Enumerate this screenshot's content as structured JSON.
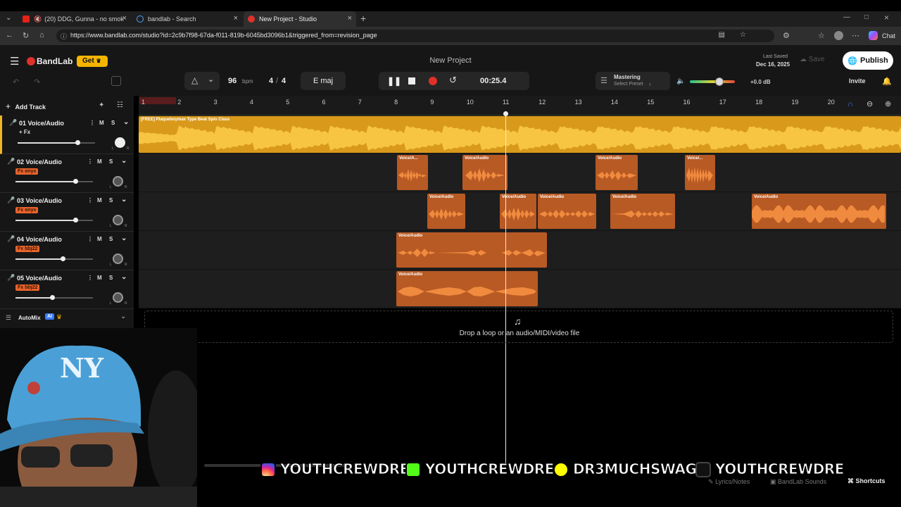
{
  "browser": {
    "tabs": [
      {
        "label": "(20) DDG, Gunna - no smok",
        "active": false
      },
      {
        "label": "bandlab - Search",
        "active": false
      },
      {
        "label": "New Project - Studio",
        "active": true
      }
    ],
    "new_tab_icon": "plus-icon",
    "url": "https://www.bandlab.com/studio?id=2c9b7f98-67da-f011-819b-6045bd3096b1&triggered_from=revision_page",
    "chat_label": "Chat"
  },
  "header": {
    "brand": "BandLab",
    "get_label": "Get",
    "project_title": "New Project",
    "last_saved_label": "Last Saved",
    "last_saved_date": "Dec 16, 2025",
    "save_label": "Save",
    "publish_label": "Publish",
    "invite_label": "Invite"
  },
  "toolbar": {
    "tempo": "96",
    "tempo_unit": "bpm",
    "time_sig_num": "4",
    "time_sig_sep": "/",
    "time_sig_den": "4",
    "key": "E maj",
    "time": "00:25.4",
    "mastering_label": "Mastering",
    "mastering_preset": "Select Preset",
    "master_volume": "+0.0 dB"
  },
  "ruler": {
    "bars": [
      "1",
      "2",
      "3",
      "4",
      "5",
      "6",
      "7",
      "8",
      "9",
      "10",
      "11",
      "12",
      "13",
      "14",
      "15",
      "16",
      "17",
      "18",
      "19",
      "20"
    ]
  },
  "sidebar": {
    "add_track_label": "Add Track",
    "automix_label": "AutoMix",
    "ai_badge": "AI"
  },
  "tracks": [
    {
      "name": "01  Voice/Audio",
      "fx": "+ Fx",
      "fx_tag": false,
      "volume": 0.77,
      "dial_on": true
    },
    {
      "name": "02  Voice/Audio",
      "fx": "Fx onyx",
      "fx_tag": true,
      "volume": 0.77,
      "dial_on": false
    },
    {
      "name": "03  Voice/Audio",
      "fx": "Fx onyx",
      "fx_tag": true,
      "volume": 0.77,
      "dial_on": false
    },
    {
      "name": "04  Voice/Audio",
      "fx": "Fx bbj22",
      "fx_tag": true,
      "volume": 0.61,
      "dial_on": false
    },
    {
      "name": "05  Voice/Audio",
      "fx": "Fx bbj22",
      "fx_tag": true,
      "volume": 0.47,
      "dial_on": false
    }
  ],
  "clips": {
    "beat_label": "[FREE] Plaqueboymax Type Beat Spin Class",
    "clip_label": "Voice/Audio",
    "clip_label_short_a": "Voice/A...",
    "clip_label_short_b": "Voice/..."
  },
  "dropzone": {
    "text": "Drop a loop or an audio/MIDI/video file"
  },
  "footer": {
    "lyrics_label": "Lyrics/Notes",
    "sounds_label": "BandLab Sounds",
    "shortcuts_label": "Shortcuts"
  },
  "socials": {
    "instagram": "YOUTHCREWDRE",
    "kick": "YOUTHCREWDRE",
    "snapchat": "DR3MUCHSWAG",
    "tiktok": "YOUTHCREWDRE"
  },
  "colors": {
    "accent_orange": "#e8642c",
    "beat_yellow": "#f0b429",
    "clip_orange": "#c0622a",
    "record_red": "#e0302a",
    "get_badge": "#f5b400"
  }
}
